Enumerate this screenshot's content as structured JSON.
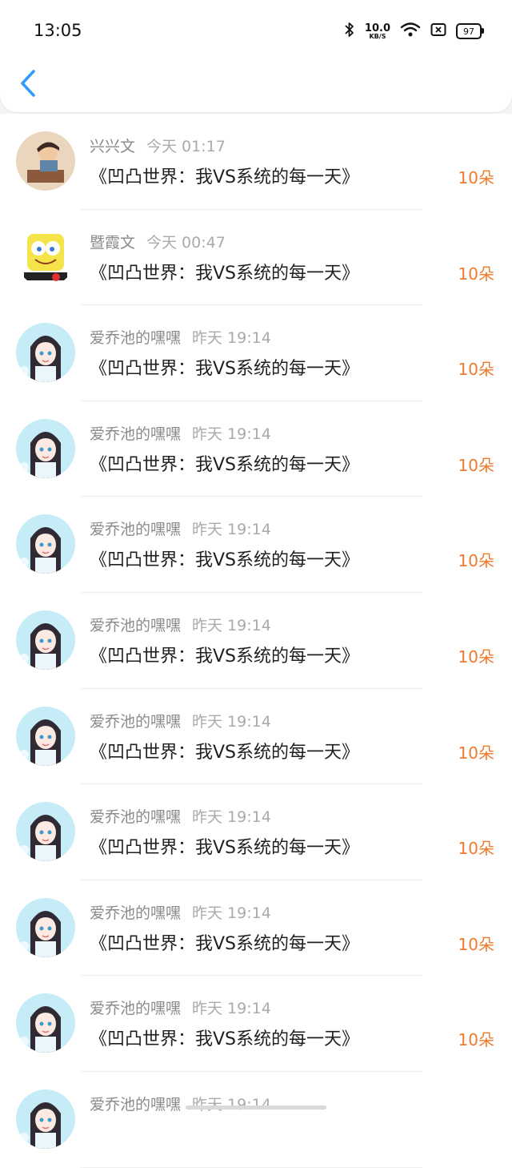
{
  "status_bar": {
    "time": "13:05",
    "net_speed_value": "10.0",
    "net_speed_unit": "KB/S",
    "battery": "97",
    "icons": [
      "bluetooth-icon",
      "wifi-icon",
      "sim-off-icon",
      "battery-icon"
    ]
  },
  "nav": {
    "back_icon": "chevron-left-icon",
    "accent": "#2f9bff"
  },
  "colors": {
    "amount": "#ef7a2a",
    "name": "#8a8a8a",
    "time": "#aaaaaa"
  },
  "records": [
    {
      "name": "兴兴文",
      "time": "今天 01:17",
      "title": "《凹凸世界：我VS系统的每一天》",
      "amount": "10朵",
      "avatar": "child-photo-avatar"
    },
    {
      "name": "暨霞文",
      "time": "今天 00:47",
      "title": "《凹凸世界：我VS系统的每一天》",
      "amount": "10朵",
      "avatar": "spongebob-avatar"
    },
    {
      "name": "爱乔池的嘿嘿",
      "time": "昨天 19:14",
      "title": "《凹凸世界：我VS系统的每一天》",
      "amount": "10朵",
      "avatar": "anime-girl-avatar"
    },
    {
      "name": "爱乔池的嘿嘿",
      "time": "昨天 19:14",
      "title": "《凹凸世界：我VS系统的每一天》",
      "amount": "10朵",
      "avatar": "anime-girl-avatar"
    },
    {
      "name": "爱乔池的嘿嘿",
      "time": "昨天 19:14",
      "title": "《凹凸世界：我VS系统的每一天》",
      "amount": "10朵",
      "avatar": "anime-girl-avatar"
    },
    {
      "name": "爱乔池的嘿嘿",
      "time": "昨天 19:14",
      "title": "《凹凸世界：我VS系统的每一天》",
      "amount": "10朵",
      "avatar": "anime-girl-avatar"
    },
    {
      "name": "爱乔池的嘿嘿",
      "time": "昨天 19:14",
      "title": "《凹凸世界：我VS系统的每一天》",
      "amount": "10朵",
      "avatar": "anime-girl-avatar"
    },
    {
      "name": "爱乔池的嘿嘿",
      "time": "昨天 19:14",
      "title": "《凹凸世界：我VS系统的每一天》",
      "amount": "10朵",
      "avatar": "anime-girl-avatar"
    },
    {
      "name": "爱乔池的嘿嘿",
      "time": "昨天 19:14",
      "title": "《凹凸世界：我VS系统的每一天》",
      "amount": "10朵",
      "avatar": "anime-girl-avatar"
    },
    {
      "name": "爱乔池的嘿嘿",
      "time": "昨天 19:14",
      "title": "《凹凸世界：我VS系统的每一天》",
      "amount": "10朵",
      "avatar": "anime-girl-avatar"
    },
    {
      "name": "爱乔池的嘿嘿",
      "time": "昨天 19:14",
      "title": "",
      "amount": "",
      "avatar": "anime-girl-avatar"
    }
  ]
}
